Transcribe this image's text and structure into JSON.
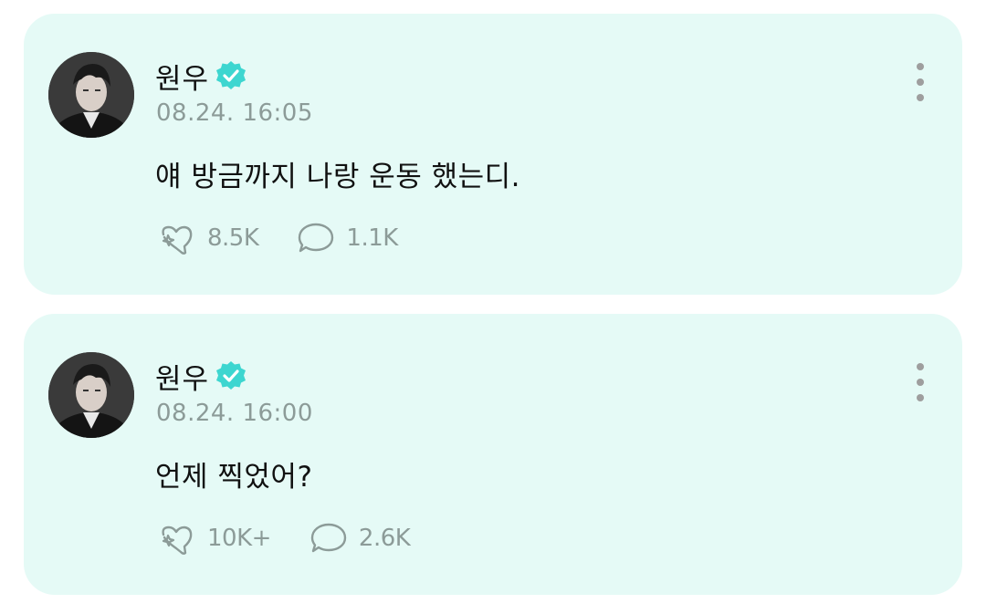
{
  "colors": {
    "card_background": "#e5faf6",
    "verified_badge": "#3dd6d0",
    "meta_text": "#8c9b98",
    "primary_text": "#111111"
  },
  "posts": [
    {
      "author": "원우",
      "verified": true,
      "timestamp": "08.24. 16:05",
      "message": "얘 방금까지 나랑 운동 했는디.",
      "likes": "8.5K",
      "comments": "1.1K",
      "like_icon": "sparkle-heart-icon",
      "comment_icon": "speech-bubble-icon",
      "menu_icon": "more-vertical-icon"
    },
    {
      "author": "원우",
      "verified": true,
      "timestamp": "08.24. 16:00",
      "message": "언제 찍었어?",
      "likes": "10K+",
      "comments": "2.6K",
      "like_icon": "sparkle-heart-icon",
      "comment_icon": "speech-bubble-icon",
      "menu_icon": "more-vertical-icon"
    }
  ]
}
